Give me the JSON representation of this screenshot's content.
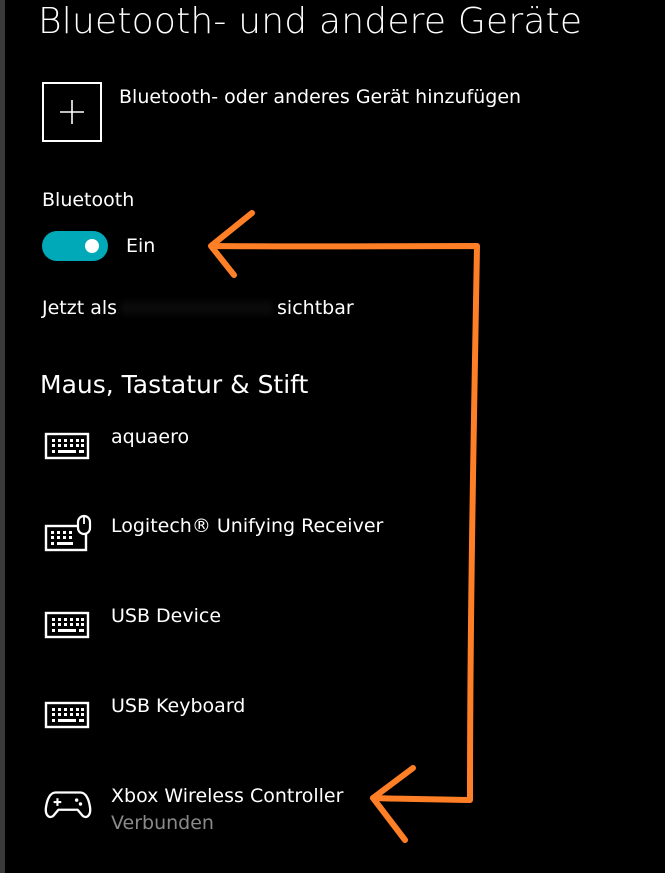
{
  "page": {
    "title": "Bluetooth- und andere Geräte"
  },
  "add_device": {
    "label": "Bluetooth- oder anderes Gerät hinzufügen",
    "icon": "plus-icon"
  },
  "bluetooth": {
    "label": "Bluetooth",
    "toggle_on": true,
    "state_label": "Ein",
    "accent_color": "#00a9b8"
  },
  "visibility": {
    "prefix": "Jetzt als",
    "suffix": "sichtbar"
  },
  "section": {
    "heading": "Maus, Tastatur & Stift"
  },
  "devices": [
    {
      "name": "aquaero",
      "icon": "keyboard-icon",
      "status": ""
    },
    {
      "name": "Logitech® Unifying Receiver",
      "icon": "keyboard-mouse-icon",
      "status": ""
    },
    {
      "name": "USB Device",
      "icon": "keyboard-icon",
      "status": ""
    },
    {
      "name": "USB Keyboard",
      "icon": "keyboard-icon",
      "status": ""
    },
    {
      "name": "Xbox Wireless Controller",
      "icon": "gamepad-icon",
      "status": "Verbunden"
    }
  ],
  "annotation": {
    "color": "#ff7f27"
  }
}
